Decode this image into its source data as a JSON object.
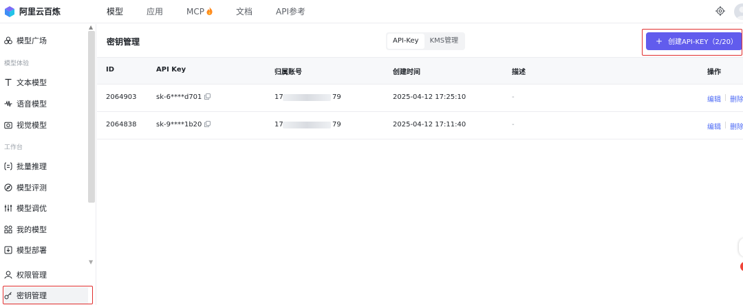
{
  "app": {
    "name": "阿里云百炼"
  },
  "nav": {
    "items": [
      "模型",
      "应用",
      "MCP",
      "文档",
      "API参考"
    ],
    "active": "模型"
  },
  "sidebar": {
    "top_item": "模型广场",
    "group1": "模型体验",
    "group1_items": [
      "文本模型",
      "语音模型",
      "视觉模型"
    ],
    "group2": "工作台",
    "group2_items": [
      "批量推理",
      "模型评测",
      "模型调优",
      "我的模型",
      "模型部署"
    ],
    "bottom_items": [
      "权限管理",
      "密钥管理"
    ],
    "selected": "密钥管理"
  },
  "page": {
    "title": "密钥管理",
    "segment": {
      "options": [
        "API-Key",
        "KMS管理"
      ],
      "active": "API-Key"
    },
    "create_button": "创建API-KEY（2/20）"
  },
  "table": {
    "columns": [
      "ID",
      "API Key",
      "归属账号",
      "创建时间",
      "描述",
      "操作"
    ],
    "rows": [
      {
        "id": "2064903",
        "api_key": "sk-6****d701",
        "account_prefix": "17",
        "account_suffix": "79",
        "created": "2025-04-12 17:25:10",
        "desc": "-",
        "edit": "编辑",
        "delete": "删除"
      },
      {
        "id": "2064838",
        "api_key": "sk-9****1b20",
        "account_prefix": "17",
        "account_suffix": "79",
        "created": "2025-04-12 17:11:40",
        "desc": "-",
        "edit": "编辑",
        "delete": "删除"
      }
    ]
  },
  "colors": {
    "accent": "#615ced",
    "link": "#4e6bf5",
    "highlight": "#e02d2d"
  }
}
